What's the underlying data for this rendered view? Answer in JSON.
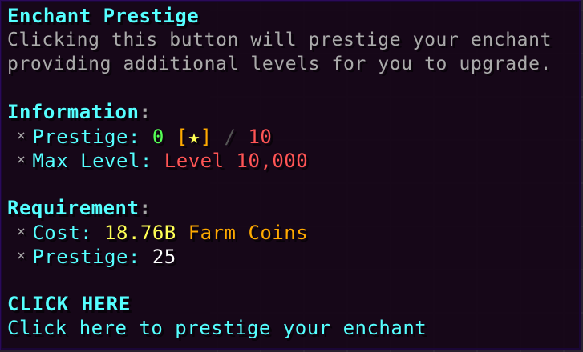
{
  "colors": {
    "aqua": "#55ffff",
    "gray": "#aaaaaa",
    "green": "#55ff55",
    "gold": "#ffaa00",
    "yellow": "#ffff55",
    "red": "#ff5555",
    "white": "#ffffff",
    "dark_gray": "#555555",
    "tooltip_bg": "#140416",
    "tooltip_border": "#2b0a5a"
  },
  "tooltip": {
    "title": "Enchant Prestige",
    "description": [
      "Clicking this button will prestige your enchant",
      "providing additional levels for you to upgrade."
    ],
    "information": {
      "heading": "Information",
      "heading_colon": ":",
      "bullet": "×",
      "prestige": {
        "label": "Prestige: ",
        "current": "0",
        "bracket_open": " [",
        "star": "★",
        "bracket_close": "]",
        "slash": " / ",
        "max": "10"
      },
      "max_level": {
        "label": "Max Level: ",
        "value": "Level 10,000"
      }
    },
    "requirement": {
      "heading": "Requirement",
      "heading_colon": ":",
      "cost": {
        "label": "Cost: ",
        "amount": "18.76B",
        "currency": " Farm Coins"
      },
      "prestige": {
        "label": "Prestige: ",
        "value": "25"
      }
    },
    "action": {
      "title": "CLICK HERE",
      "description": "Click here to prestige your enchant"
    }
  }
}
